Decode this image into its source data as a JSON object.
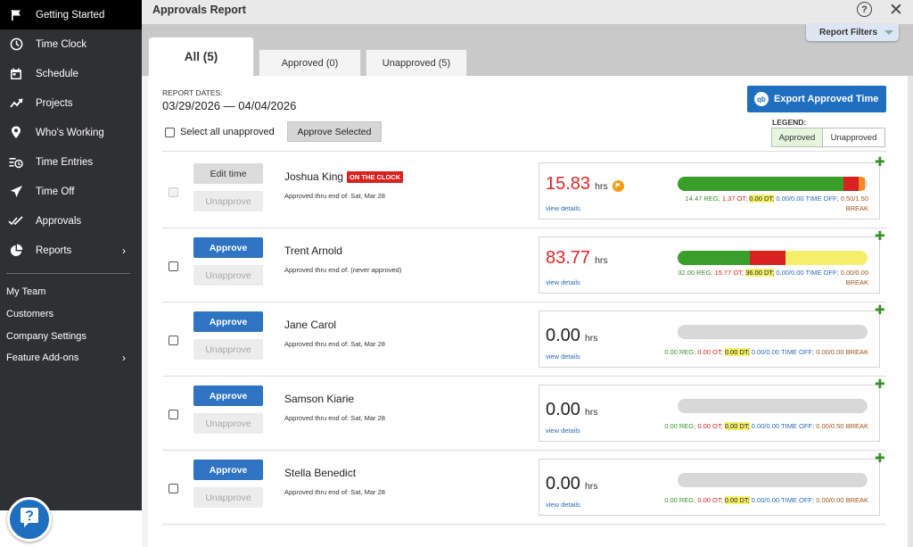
{
  "sidebar": {
    "items": [
      {
        "label": "Getting Started",
        "icon": "flag-icon",
        "active": true
      },
      {
        "label": "Time Clock",
        "icon": "clock-icon"
      },
      {
        "label": "Schedule",
        "icon": "calendar-icon"
      },
      {
        "label": "Projects",
        "icon": "trend-icon"
      },
      {
        "label": "Who's Working",
        "icon": "location-pin-icon"
      },
      {
        "label": "Time Entries",
        "icon": "time-entries-icon"
      },
      {
        "label": "Time Off",
        "icon": "airplane-icon"
      },
      {
        "label": "Approvals",
        "icon": "double-check-icon"
      },
      {
        "label": "Reports",
        "icon": "pie-chart-icon",
        "chevron": true
      }
    ],
    "sub_items": [
      {
        "label": "My Team"
      },
      {
        "label": "Customers"
      },
      {
        "label": "Company Settings"
      },
      {
        "label": "Feature Add-ons",
        "chevron": true
      }
    ],
    "help_icon": "question-chat-icon"
  },
  "header": {
    "title": "Approvals Report",
    "help_symbol": "?",
    "close_symbol": "✕",
    "filters_label": "Report Filters"
  },
  "tabs": [
    {
      "label": "All (5)",
      "active": true
    },
    {
      "label": "Approved (0)"
    },
    {
      "label": "Unapproved (5)"
    }
  ],
  "report": {
    "dates_label": "REPORT DATES:",
    "dates_value": "03/29/2026 — 04/04/2026",
    "select_all_label": "Select all unapproved",
    "approve_selected_label": "Approve Selected",
    "export_label": "Export Approved Time",
    "export_badge": "qb",
    "legend_label": "LEGEND:",
    "legend_approved": "Approved",
    "legend_unapproved": "Unapproved"
  },
  "colors": {
    "accent": "#2f73c3",
    "reg": "#3a9e2a",
    "ot": "#d8221f",
    "dt": "#f5f06b",
    "on_clock": "#d8221f"
  },
  "employees": [
    {
      "name": "Joshua King",
      "badge": "ON THE CLOCK",
      "approved_thru": "Approved thru end of: Sat, Mar 28",
      "primary_button": "Edit time",
      "secondary_button": "Unapprove",
      "hours": "15.83",
      "hours_unit": "hrs",
      "hours_highlight": true,
      "view_details": "view details",
      "reg": "14.47 REG;",
      "ot": "1.37 OT;",
      "dt": "0.00 DT;",
      "time_off": "0.00/0.00 TIME OFF;",
      "break_line1": "0.50/1.50",
      "break_line2": "BREAK",
      "bar": {
        "reg": 14.47,
        "ot": 1.37,
        "dt": 0.0,
        "break": 0.5,
        "total": 16.6
      }
    },
    {
      "name": "Trent Arnold",
      "approved_thru": "Approved thru end of: (never approved)",
      "primary_button": "Approve",
      "secondary_button": "Unapprove",
      "hours": "83.77",
      "hours_unit": "hrs",
      "hours_highlight": true,
      "view_details": "view details",
      "reg": "32.00 REG;",
      "ot": "15.77 OT;",
      "dt": "36.00 DT;",
      "time_off": "0.00/0.00 TIME OFF;",
      "break_line1": "0.00/0.00",
      "break_line2": "BREAK",
      "bar": {
        "reg": 32.0,
        "ot": 15.77,
        "dt": 36.0,
        "break": 0,
        "total": 83.77
      }
    },
    {
      "name": "Jane Carol",
      "approved_thru": "Approved thru end of: Sat, Mar 28",
      "primary_button": "Approve",
      "secondary_button": "Unapprove",
      "hours": "0.00",
      "hours_unit": "hrs",
      "hours_highlight": false,
      "view_details": "view details",
      "reg": "0.00 REG;",
      "ot": "0.00 OT;",
      "dt": "0.00 DT;",
      "time_off": "0.00/0.00 TIME OFF;",
      "break_line1": "0.00/0.00 BREAK",
      "break_line2": "",
      "bar": {
        "reg": 0,
        "ot": 0,
        "dt": 0,
        "break": 0,
        "total": 0
      }
    },
    {
      "name": "Samson Kiarie",
      "approved_thru": "Approved thru end of: Sat, Mar 28",
      "primary_button": "Approve",
      "secondary_button": "Unapprove",
      "hours": "0.00",
      "hours_unit": "hrs",
      "hours_highlight": false,
      "view_details": "view details",
      "reg": "0.00 REG;",
      "ot": "0.00 OT;",
      "dt": "0.00 DT;",
      "time_off": "0.00/0.00 TIME OFF;",
      "break_line1": "0.00/0.50 BREAK",
      "break_line2": "",
      "bar": {
        "reg": 0,
        "ot": 0,
        "dt": 0,
        "break": 0,
        "total": 0
      }
    },
    {
      "name": "Stella Benedict",
      "approved_thru": "Approved thru end of: Sat, Mar 28",
      "primary_button": "Approve",
      "secondary_button": "Unapprove",
      "hours": "0.00",
      "hours_unit": "hrs",
      "hours_highlight": false,
      "view_details": "view details",
      "reg": "0.00 REG;",
      "ot": "0.00 OT;",
      "dt": "0.00 DT;",
      "time_off": "0.00/0.00 TIME OFF;",
      "break_line1": "0.00/0.00 BREAK",
      "break_line2": "",
      "bar": {
        "reg": 0,
        "ot": 0,
        "dt": 0,
        "break": 0,
        "total": 0
      }
    }
  ]
}
